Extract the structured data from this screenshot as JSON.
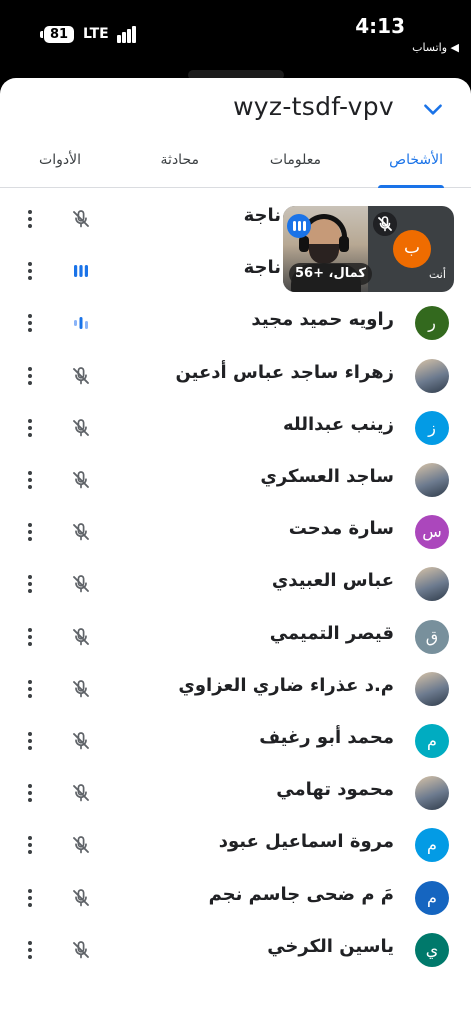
{
  "status": {
    "battery": "81",
    "network": "LTE",
    "time": "4:13",
    "back_app": "◀ واتساب"
  },
  "meeting": {
    "code": "wyz-tsdf-vpv"
  },
  "tabs": [
    {
      "label": "الأشخاص",
      "active": true
    },
    {
      "label": "معلومات",
      "active": false
    },
    {
      "label": "محادثة",
      "active": false
    },
    {
      "label": "الأدوات",
      "active": false
    }
  ],
  "self_tile": {
    "participant_count": "+56",
    "name_fragment": "كمال",
    "self_initial": "ب",
    "self_label": "أنت"
  },
  "participants": [
    {
      "name": "ناجة",
      "initial": "",
      "avatar_color": "#7b1fa2",
      "mic": "muted",
      "photo": false,
      "partially_hidden": true
    },
    {
      "name": "ناجة",
      "initial": "",
      "avatar_color": "#5f6368",
      "mic": "speaking",
      "photo": false,
      "partially_hidden": true
    },
    {
      "name": "راويه حميد مجيد",
      "initial": "ر",
      "avatar_color": "#33691e",
      "mic": "speaking-dim",
      "photo": false
    },
    {
      "name": "زهراء ساجد عباس أدعين",
      "initial": "",
      "avatar_color": "#8d8d8d",
      "mic": "muted",
      "photo": true
    },
    {
      "name": "زينب عبدالله",
      "initial": "ز",
      "avatar_color": "#039be5",
      "mic": "muted",
      "photo": false
    },
    {
      "name": "ساجد العسكري",
      "initial": "",
      "avatar_color": "#8d8d8d",
      "mic": "muted",
      "photo": true
    },
    {
      "name": "سارة مدحت",
      "initial": "س",
      "avatar_color": "#ab47bc",
      "mic": "muted",
      "photo": false
    },
    {
      "name": "عباس العبيدي",
      "initial": "",
      "avatar_color": "#8d8d8d",
      "mic": "muted",
      "photo": true
    },
    {
      "name": "قيصر التميمي",
      "initial": "ق",
      "avatar_color": "#78909c",
      "mic": "muted",
      "photo": false
    },
    {
      "name": "م.د عذراء ضاري العزاوي",
      "initial": "",
      "avatar_color": "#8d8d8d",
      "mic": "muted",
      "photo": true
    },
    {
      "name": "محمد أبو رغيف",
      "initial": "م",
      "avatar_color": "#00acc1",
      "mic": "muted",
      "photo": false
    },
    {
      "name": "محمود تهامي",
      "initial": "",
      "avatar_color": "#8d8d8d",
      "mic": "muted",
      "photo": true
    },
    {
      "name": "مروة اسماعيل عبود",
      "initial": "م",
      "avatar_color": "#039be5",
      "mic": "muted",
      "photo": false
    },
    {
      "name": "مَ م ضحى جاسم نجم",
      "initial": "م",
      "avatar_color": "#1565c0",
      "mic": "muted",
      "photo": false
    },
    {
      "name": "ياسين الكرخي",
      "initial": "ي",
      "avatar_color": "#00796b",
      "mic": "muted",
      "photo": false
    }
  ]
}
